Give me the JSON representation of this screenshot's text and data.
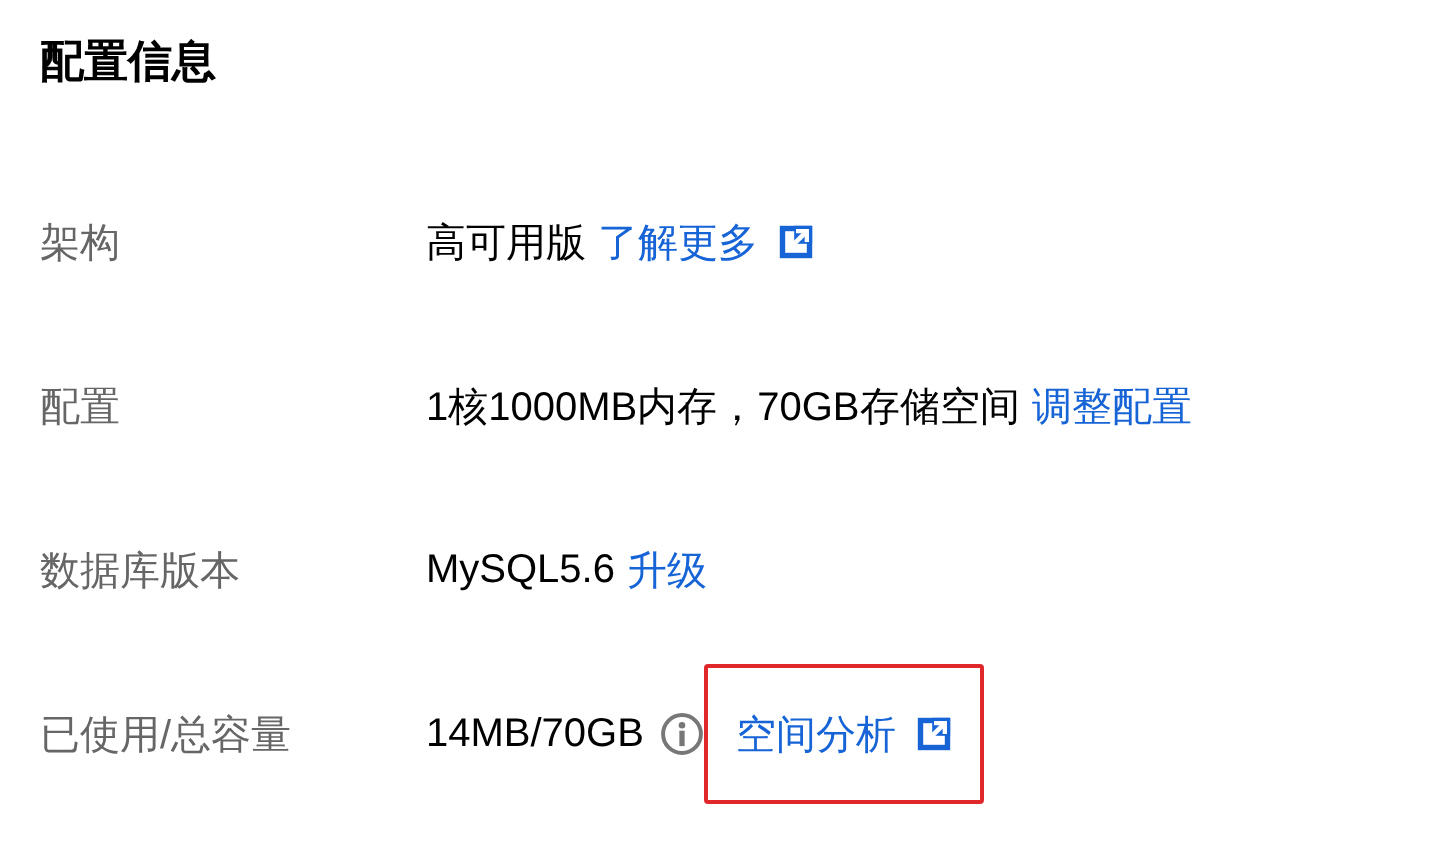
{
  "title": "配置信息",
  "rows": [
    {
      "label": "架构",
      "value": "高可用版",
      "info": false,
      "link": {
        "text": "了解更多",
        "external": true
      },
      "highlighted": false
    },
    {
      "label": "配置",
      "value": "1核1000MB内存，70GB存储空间",
      "info": false,
      "link": {
        "text": "调整配置",
        "external": false
      },
      "highlighted": false
    },
    {
      "label": "数据库版本",
      "value": "MySQL5.6",
      "info": false,
      "link": {
        "text": "升级",
        "external": false
      },
      "highlighted": false
    },
    {
      "label": "已使用/总容量",
      "value": "14MB/70GB",
      "info": true,
      "link": {
        "text": "空间分析",
        "external": true
      },
      "highlighted": true
    }
  ]
}
